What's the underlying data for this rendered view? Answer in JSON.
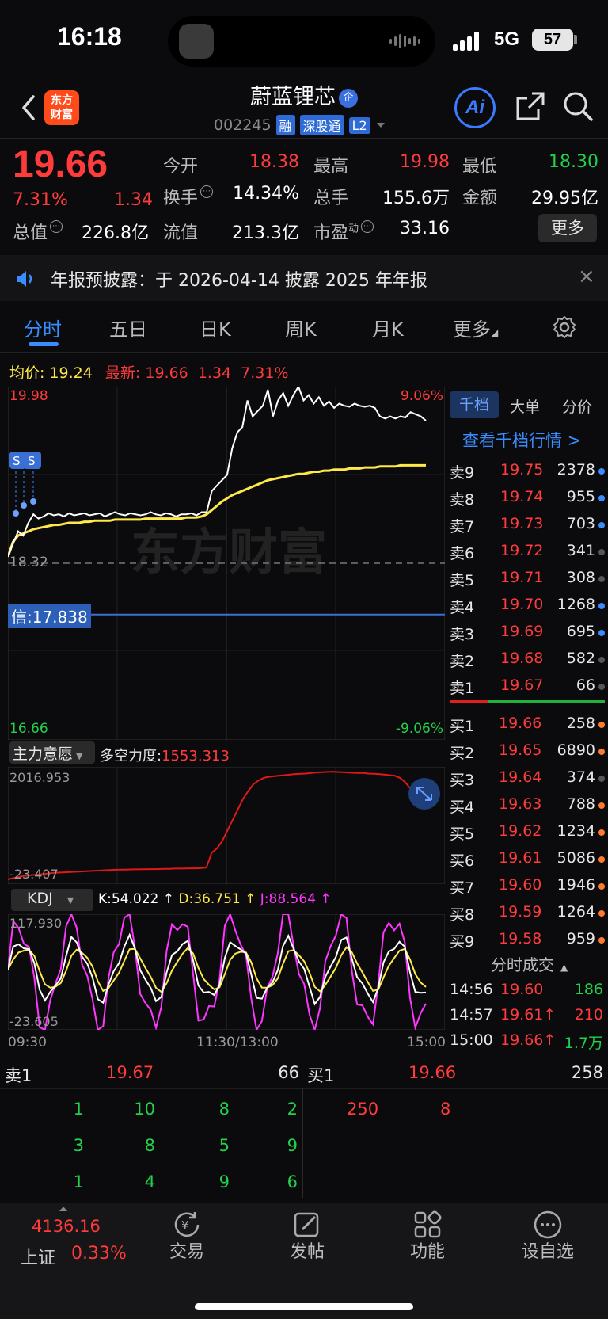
{
  "status_bar": {
    "time": "16:18",
    "network": "5G",
    "battery": "57"
  },
  "header": {
    "title": "蔚蓝锂芯",
    "title_badge": "企",
    "code": "002245",
    "tags": [
      "融",
      "深股通",
      "L2"
    ],
    "logo_text_1": "东方",
    "logo_text_2": "财富",
    "ai_label": "Ai"
  },
  "quote": {
    "price": "19.66",
    "change_pct": "7.31%",
    "change": "1.34",
    "items": [
      {
        "label": "今开",
        "value": "18.38",
        "color": "red"
      },
      {
        "label": "最高",
        "value": "19.98",
        "color": "red"
      },
      {
        "label": "最低",
        "value": "18.30",
        "color": "green"
      },
      {
        "label": "换手",
        "value": "14.34%",
        "color": "white",
        "info": true
      },
      {
        "label": "总手",
        "value": "155.6万",
        "color": "white"
      },
      {
        "label": "金额",
        "value": "29.95亿",
        "color": "white"
      },
      {
        "label": "总值",
        "value": "226.8亿",
        "color": "white",
        "info": true
      },
      {
        "label": "流值",
        "value": "213.3亿",
        "color": "white"
      },
      {
        "label": "市盈",
        "label_sup": "动",
        "value": "33.16",
        "color": "white",
        "info": true
      }
    ],
    "more_label": "更多"
  },
  "notice": {
    "text": "年报预披露：于 2026-04-14 披露 2025 年年报"
  },
  "tabs": [
    "分时",
    "五日",
    "日K",
    "周K",
    "月K",
    "更多"
  ],
  "active_tab": 0,
  "chart": {
    "avg_label": "均价:",
    "avg_value": "19.24",
    "latest_label": "最新:",
    "latest_value": "19.66",
    "latest_change": "1.34",
    "latest_pct": "7.31%",
    "y_top": "19.98",
    "y_top_pct": "9.06%",
    "y_bottom": "16.66",
    "y_bottom_pct": "-9.06%",
    "prev_close_label": "18.32",
    "credit_line_label": "信:17.838",
    "watermark": "东方财富",
    "x_labels": [
      "09:30",
      "11:30/13:00",
      "15:00"
    ],
    "ylim": [
      16.66,
      19.98
    ],
    "prev_close": 18.32,
    "credit_line": 17.838,
    "price_series": [
      18.38,
      18.5,
      18.62,
      18.58,
      18.7,
      18.78,
      18.74,
      18.76,
      18.79,
      18.77,
      18.78,
      18.76,
      18.79,
      18.77,
      18.78,
      18.79,
      18.77,
      18.78,
      18.79,
      18.76,
      18.78,
      18.8,
      18.78,
      18.77,
      18.79,
      18.78,
      18.77,
      18.78,
      18.8,
      18.78,
      18.77,
      18.79,
      18.78,
      18.76,
      18.78,
      18.78,
      18.79,
      18.77,
      18.8,
      18.8,
      19.0,
      19.05,
      19.1,
      19.15,
      19.4,
      19.55,
      19.6,
      19.85,
      19.7,
      19.75,
      19.8,
      19.95,
      19.7,
      19.85,
      19.92,
      19.8,
      19.9,
      19.98,
      19.85,
      19.9,
      19.82,
      19.88,
      19.8,
      19.84,
      19.78,
      19.82,
      19.8,
      19.79,
      19.82,
      19.8,
      19.79,
      19.8,
      19.78,
      19.7,
      19.68,
      19.7,
      19.68,
      19.7,
      19.69,
      19.74,
      19.72,
      19.7,
      19.66
    ],
    "avg_series": [
      18.38,
      18.52,
      18.58,
      18.6,
      18.62,
      18.64,
      18.65,
      18.66,
      18.67,
      18.68,
      18.68,
      18.69,
      18.7,
      18.7,
      18.7,
      18.71,
      18.71,
      18.72,
      18.72,
      18.72,
      18.72,
      18.73,
      18.73,
      18.73,
      18.73,
      18.73,
      18.73,
      18.74,
      18.74,
      18.74,
      18.74,
      18.74,
      18.74,
      18.74,
      18.74,
      18.75,
      18.75,
      18.75,
      18.76,
      18.78,
      18.82,
      18.86,
      18.9,
      18.93,
      18.96,
      18.98,
      19.0,
      19.02,
      19.04,
      19.06,
      19.08,
      19.1,
      19.11,
      19.12,
      19.13,
      19.14,
      19.15,
      19.16,
      19.16,
      19.17,
      19.18,
      19.18,
      19.19,
      19.19,
      19.2,
      19.2,
      19.2,
      19.21,
      19.21,
      19.21,
      19.22,
      19.22,
      19.22,
      19.23,
      19.23,
      19.23,
      19.23,
      19.24,
      19.24,
      19.24,
      19.24,
      19.24,
      19.24
    ]
  },
  "flow": {
    "dropdown_label": "主力意愿",
    "power_label": "多空力度:",
    "power_value": "1553.313",
    "y_top": "2016.953",
    "y_bottom": "-23.407",
    "ylim": [
      -23.407,
      2016.953
    ],
    "series": [
      -23,
      0,
      20,
      40,
      50,
      60,
      70,
      80,
      90,
      100,
      105,
      110,
      115,
      120,
      125,
      130,
      135,
      140,
      145,
      150,
      155,
      160,
      160,
      162,
      165,
      165,
      168,
      170,
      170,
      172,
      175,
      175,
      180,
      180,
      182,
      185,
      185,
      190,
      200,
      480,
      560,
      700,
      900,
      1100,
      1300,
      1500,
      1650,
      1780,
      1850,
      1900,
      1920,
      1930,
      1940,
      1950,
      1960,
      1970,
      1975,
      1980,
      1990,
      2000,
      2005,
      2010,
      2016,
      2010,
      2005,
      2000,
      1995,
      1990,
      1990,
      1980,
      1975,
      1970,
      1960,
      1950,
      1940,
      1900,
      1820,
      1700,
      1620,
      1560,
      1553
    ]
  },
  "kdj": {
    "dropdown_label": "KDJ",
    "k_text": "K:54.022 ↑",
    "d_text": "D:36.751 ↑",
    "j_text": "J:88.564 ↑",
    "y_top": "117.930",
    "y_bottom": "-23.605",
    "ylim": [
      -23.605,
      117.93
    ],
    "k_color": "#ffffff",
    "d_color": "#ffe94a",
    "j_color": "#ff36ff"
  },
  "order_book": {
    "tabs": [
      "千档",
      "大单",
      "分价"
    ],
    "link_text": "查看千档行情 >",
    "asks": [
      {
        "label": "卖9",
        "price": "19.75",
        "vol": "2378",
        "dot": "#3a8dff"
      },
      {
        "label": "卖8",
        "price": "19.74",
        "vol": "955",
        "dot": "#3a8dff"
      },
      {
        "label": "卖7",
        "price": "19.73",
        "vol": "703",
        "dot": "#3a8dff"
      },
      {
        "label": "卖6",
        "price": "19.72",
        "vol": "341",
        "dot": "#555"
      },
      {
        "label": "卖5",
        "price": "19.71",
        "vol": "308",
        "dot": "#555"
      },
      {
        "label": "卖4",
        "price": "19.70",
        "vol": "1268",
        "dot": "#3a8dff"
      },
      {
        "label": "卖3",
        "price": "19.69",
        "vol": "695",
        "dot": "#3a8dff"
      },
      {
        "label": "卖2",
        "price": "19.68",
        "vol": "582",
        "dot": "#555"
      },
      {
        "label": "卖1",
        "price": "19.67",
        "vol": "66",
        "dot": "#555"
      }
    ],
    "bids": [
      {
        "label": "买1",
        "price": "19.66",
        "vol": "258",
        "dot": "#ff7a2a"
      },
      {
        "label": "买2",
        "price": "19.65",
        "vol": "6890",
        "dot": "#ff7a2a"
      },
      {
        "label": "买3",
        "price": "19.64",
        "vol": "374",
        "dot": "#555"
      },
      {
        "label": "买4",
        "price": "19.63",
        "vol": "788",
        "dot": "#ff7a2a"
      },
      {
        "label": "买5",
        "price": "19.62",
        "vol": "1234",
        "dot": "#ff7a2a"
      },
      {
        "label": "买6",
        "price": "19.61",
        "vol": "5086",
        "dot": "#ff7a2a"
      },
      {
        "label": "买7",
        "price": "19.60",
        "vol": "1946",
        "dot": "#ff7a2a"
      },
      {
        "label": "买8",
        "price": "19.59",
        "vol": "1264",
        "dot": "#ff7a2a"
      },
      {
        "label": "买9",
        "price": "19.58",
        "vol": "959",
        "dot": "#ff7a2a"
      }
    ],
    "trades_title": "分时成交",
    "trades": [
      {
        "time": "14:56",
        "price": "19.60",
        "vol": "186",
        "vol_color": "green"
      },
      {
        "time": "14:57",
        "price": "19.61↑",
        "vol": "210",
        "vol_color": "red"
      },
      {
        "time": "15:00",
        "price": "19.66↑",
        "vol": "1.7万",
        "vol_color": "green"
      }
    ]
  },
  "bottom_book": {
    "ask_label": "卖1",
    "ask_price": "19.67",
    "ask_vol": "66",
    "bid_label": "买1",
    "bid_price": "19.66",
    "bid_vol": "258",
    "ask_orders": [
      [
        "1",
        "10",
        "8",
        "2"
      ],
      [
        "3",
        "8",
        "5",
        "9"
      ],
      [
        "1",
        "4",
        "9",
        "6"
      ]
    ],
    "bid_orders": [
      "250",
      "8"
    ]
  },
  "bottom_nav": {
    "index_value": "4136.16",
    "index_name": "上证",
    "index_pct": "0.33%",
    "items": [
      "交易",
      "发帖",
      "功能",
      "设自选"
    ]
  }
}
